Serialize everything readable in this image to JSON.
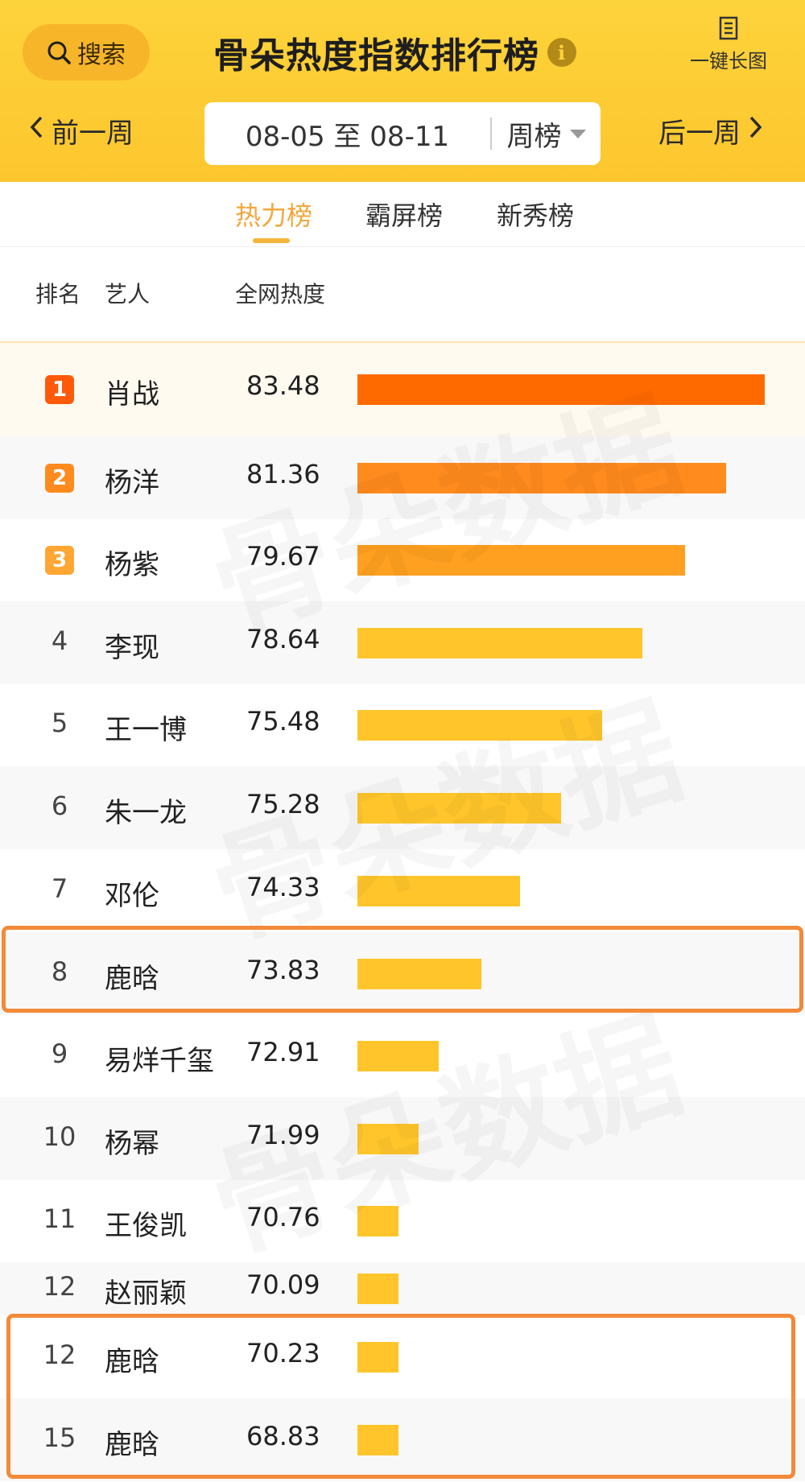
{
  "header": {
    "search_label": "搜索",
    "title": "骨朵热度指数排行榜",
    "info_icon": "i",
    "long_image_label": "一键长图",
    "prev_label": "前一周",
    "next_label": "后一周",
    "date_range": "08-05 至 08-11",
    "period": "周榜"
  },
  "tabs": [
    {
      "label": "热力榜",
      "active": true
    },
    {
      "label": "霸屏榜",
      "active": false
    },
    {
      "label": "新秀榜",
      "active": false
    }
  ],
  "columns": {
    "rank": "排名",
    "artist": "艺人",
    "heat": "全网热度"
  },
  "rows": [
    {
      "rank": "1",
      "name": "肖战",
      "score": "83.48",
      "bar": 1.0,
      "color": "#ff6a00"
    },
    {
      "rank": "2",
      "name": "杨洋",
      "score": "81.36",
      "bar": 0.905,
      "color": "#ff8a1e"
    },
    {
      "rank": "3",
      "name": "杨紫",
      "score": "79.67",
      "bar": 0.805,
      "color": "#ffa020"
    },
    {
      "rank": "4",
      "name": "李现",
      "score": "78.64",
      "bar": 0.7,
      "color": "#ffc52a"
    },
    {
      "rank": "5",
      "name": "王一博",
      "score": "75.48",
      "bar": 0.6,
      "color": "#ffc52a"
    },
    {
      "rank": "6",
      "name": "朱一龙",
      "score": "75.28",
      "bar": 0.5,
      "color": "#ffc52a"
    },
    {
      "rank": "7",
      "name": "邓伦",
      "score": "74.33",
      "bar": 0.4,
      "color": "#ffc52a"
    },
    {
      "rank": "8",
      "name": "鹿晗",
      "score": "73.83",
      "bar": 0.305,
      "color": "#ffc52a"
    },
    {
      "rank": "9",
      "name": "易烊千玺",
      "score": "72.91",
      "bar": 0.2,
      "color": "#ffc52a"
    },
    {
      "rank": "10",
      "name": "杨幂",
      "score": "71.99",
      "bar": 0.15,
      "color": "#ffc52a"
    },
    {
      "rank": "11",
      "name": "王俊凯",
      "score": "70.76",
      "bar": 0.1,
      "color": "#ffc52a"
    },
    {
      "rank": "12",
      "name": "赵丽颖",
      "score": "70.09",
      "bar": 0.1,
      "color": "#ffc52a"
    },
    {
      "rank": "12",
      "name": "鹿晗",
      "score": "70.23",
      "bar": 0.1,
      "color": "#ffc52a"
    },
    {
      "rank": "15",
      "name": "鹿晗",
      "score": "68.83",
      "bar": 0.1,
      "color": "#ffc52a"
    }
  ],
  "watermark": {
    "brand": "骨朵数据"
  },
  "colors": {
    "header_bg": "#fdcf36",
    "active_tab": "#f2a73a",
    "highlight_border": "#f28a3a"
  }
}
